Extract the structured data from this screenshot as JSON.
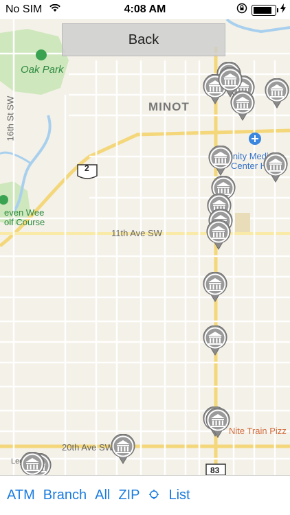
{
  "status_bar": {
    "carrier": "No SIM",
    "time": "4:08 AM"
  },
  "map": {
    "labels": {
      "park": "Oak Park",
      "city": "MINOT",
      "street_16th": "16th St SW",
      "street_11th": "11th Ave SW",
      "street_20th": "20th Ave SW",
      "hospital_line1": "inity Medical",
      "hospital_line2": "Center He",
      "golf_line1": "even Wee",
      "golf_line2": "olf Course",
      "pizza": "Nite Train Pizz",
      "legal": "Legal",
      "route_2": "2",
      "route_83": "83"
    }
  },
  "back_button": "Back",
  "toolbar": {
    "atm": "ATM",
    "branch": "Branch",
    "all": "All",
    "zip": "ZIP",
    "list": "List",
    "location_icon": "crosshair-icon"
  },
  "pins": {
    "icon": "bank-icon",
    "count": 19
  }
}
